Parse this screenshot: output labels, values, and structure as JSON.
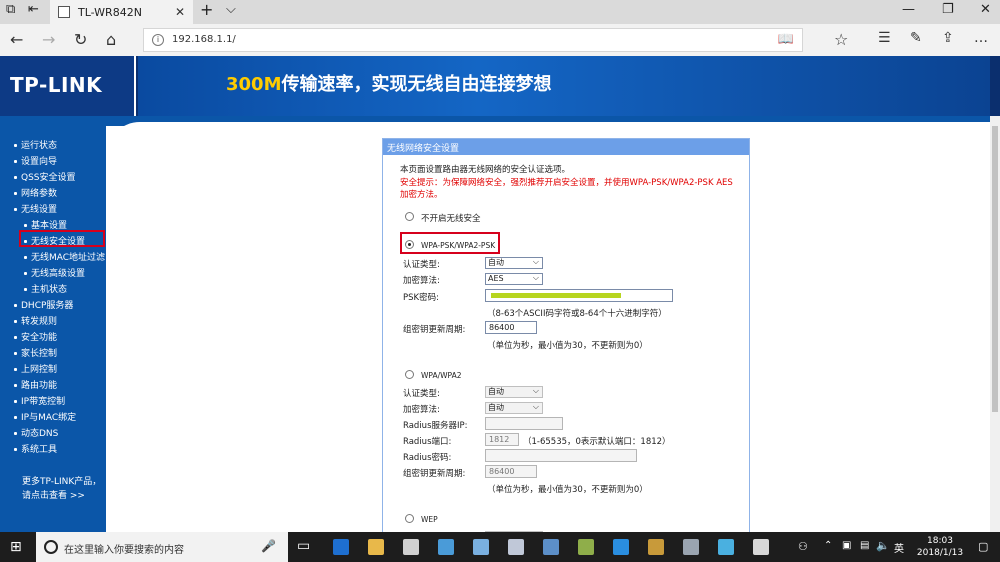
{
  "browser": {
    "tab_title": "TL-WR842N",
    "url": "192.168.1.1/"
  },
  "banner": {
    "logo": "TP-LINK",
    "slogan_highlight": "300M",
    "slogan_rest": "传输速率，实现无线自由连接梦想"
  },
  "sidebar": {
    "items": [
      {
        "label": "运行状态"
      },
      {
        "label": "设置向导"
      },
      {
        "label": "QSS安全设置"
      },
      {
        "label": "网络参数"
      },
      {
        "label": "无线设置"
      },
      {
        "label": "基本设置"
      },
      {
        "label": "无线安全设置"
      },
      {
        "label": "无线MAC地址过滤"
      },
      {
        "label": "无线高级设置"
      },
      {
        "label": "主机状态"
      },
      {
        "label": "DHCP服务器"
      },
      {
        "label": "转发规则"
      },
      {
        "label": "安全功能"
      },
      {
        "label": "家长控制"
      },
      {
        "label": "上网控制"
      },
      {
        "label": "路由功能"
      },
      {
        "label": "IP带宽控制"
      },
      {
        "label": "IP与MAC绑定"
      },
      {
        "label": "动态DNS"
      },
      {
        "label": "系统工具"
      }
    ],
    "more_line1": "更多TP-LINK产品，",
    "more_line2": "请点击查看 >>"
  },
  "panel": {
    "title": "无线网络安全设置",
    "intro": "本页面设置路由器无线网络的安全认证选项。",
    "warn1": "安全提示：为保障网络安全，强烈推荐开启安全设置，并使用WPA-PSK/WPA2-PSK AES",
    "warn2": "加密方法。",
    "opt_none": "不开启无线安全",
    "opt_psk": "WPA-PSK/WPA2-PSK",
    "psk": {
      "auth_label": "认证类型:",
      "auth_value": "自动",
      "enc_label": "加密算法:",
      "enc_value": "AES",
      "pwd_label": "PSK密码:",
      "pwd_hint": "（8-63个ASCII码字符或8-64个十六进制字符）",
      "renew_label": "组密钥更新周期:",
      "renew_value": "86400",
      "renew_hint": "（单位为秒，最小值为30，不更新则为0）"
    },
    "opt_wpa": "WPA/WPA2",
    "wpa": {
      "auth_label": "认证类型:",
      "auth_value": "自动",
      "enc_label": "加密算法:",
      "enc_value": "自动",
      "radius_ip_label": "Radius服务器IP:",
      "radius_port_label": "Radius端口:",
      "radius_port_value": "1812",
      "radius_port_hint": "（1-65535，0表示默认端口：1812）",
      "radius_pwd_label": "Radius密码:",
      "renew_label": "组密钥更新周期:",
      "renew_value": "86400",
      "renew_hint": "（单位为秒，最小值为30，不更新则为0）"
    },
    "opt_wep": "WEP"
  },
  "taskbar": {
    "search_placeholder": "在这里输入你要搜索的内容",
    "ime": "英",
    "time": "18:03",
    "date": "2018/1/13"
  }
}
